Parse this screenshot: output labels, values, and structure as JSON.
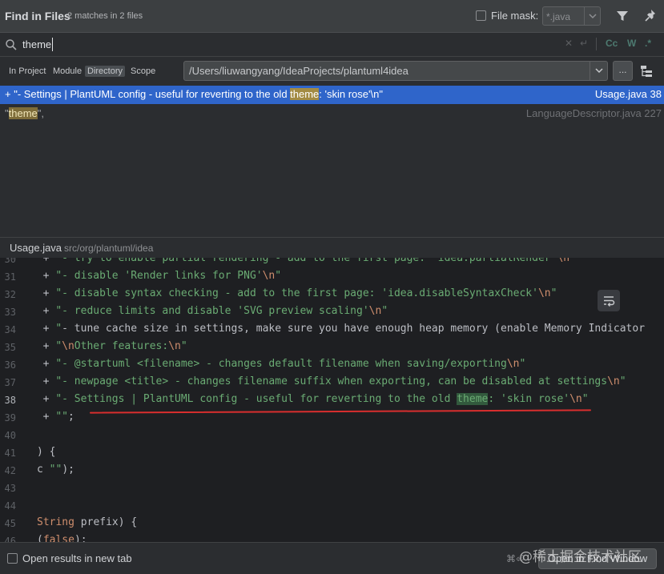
{
  "header": {
    "title": "Find in Files",
    "match_count": "2 matches in 2 files",
    "file_mask_label": "File mask:",
    "file_mask_value": "*.java"
  },
  "search": {
    "query": "theme",
    "option_case": "Cc",
    "option_words": "W",
    "option_regex": ".*"
  },
  "scope": {
    "tabs": [
      "In Project",
      "Module",
      "Directory",
      "Scope"
    ],
    "active_tab": "Directory",
    "path": "/Users/liuwangyang/IdeaProjects/plantuml4idea",
    "browse_label": "..."
  },
  "results": [
    {
      "prefix": "+ \"- Settings | PlantUML config - useful for reverting to the old ",
      "match": "theme",
      "suffix": ": 'skin rose'\\n\"",
      "file": "Usage.java 38",
      "selected": true
    },
    {
      "prefix": "\"",
      "match": "theme",
      "suffix": "\",",
      "file": "LanguageDescriptor.java 227",
      "selected": false
    }
  ],
  "preview": {
    "file": "Usage.java",
    "path": "src/org/plantuml/idea",
    "current_line": 38,
    "lines": [
      {
        "n": "30",
        "code": "  + \"- try to enable partial rendering - add to the first page: 'idea.partialRender'\\n\""
      },
      {
        "n": "31",
        "code": "  + \"- disable 'Render links for PNG'\\n\""
      },
      {
        "n": "32",
        "code": "  + \"- disable syntax checking - add to the first page: 'idea.disableSyntaxCheck'\\n\""
      },
      {
        "n": "33",
        "code": "  + \"- reduce limits and disable 'SVG preview scaling'\\n\""
      },
      {
        "n": "34",
        "code": "  + \"- tune cache size in settings, make sure you have enough heap memory (enable Memory Indicator"
      },
      {
        "n": "35",
        "code": "  + \"\\nOther features:\\n\""
      },
      {
        "n": "36",
        "code": "  + \"- @startuml <filename> - changes default filename when saving/exporting\\n\""
      },
      {
        "n": "37",
        "code": "  + \"- newpage <title> - changes filename suffix when exporting, can be disabled at settings\\n\""
      },
      {
        "n": "38",
        "code": "  + \"- Settings | PlantUML config - useful for reverting to the old theme: 'skin rose'\\n\""
      },
      {
        "n": "39",
        "code": "  + \"\";"
      },
      {
        "n": "40",
        "code": ""
      },
      {
        "n": "41",
        "code": ") {"
      },
      {
        "n": "42",
        "code": "c \"\");"
      },
      {
        "n": "43",
        "code": ""
      },
      {
        "n": "44",
        "code": ""
      },
      {
        "n": "45",
        "code": "String prefix) {"
      },
      {
        "n": "46",
        "code": "(false);"
      }
    ]
  },
  "footer": {
    "open_new_tab_label": "Open results in new tab",
    "shortcut": "⌘⏎",
    "open_button": "Open in Find Window",
    "watermark": "@稀土掘金技术社区"
  }
}
